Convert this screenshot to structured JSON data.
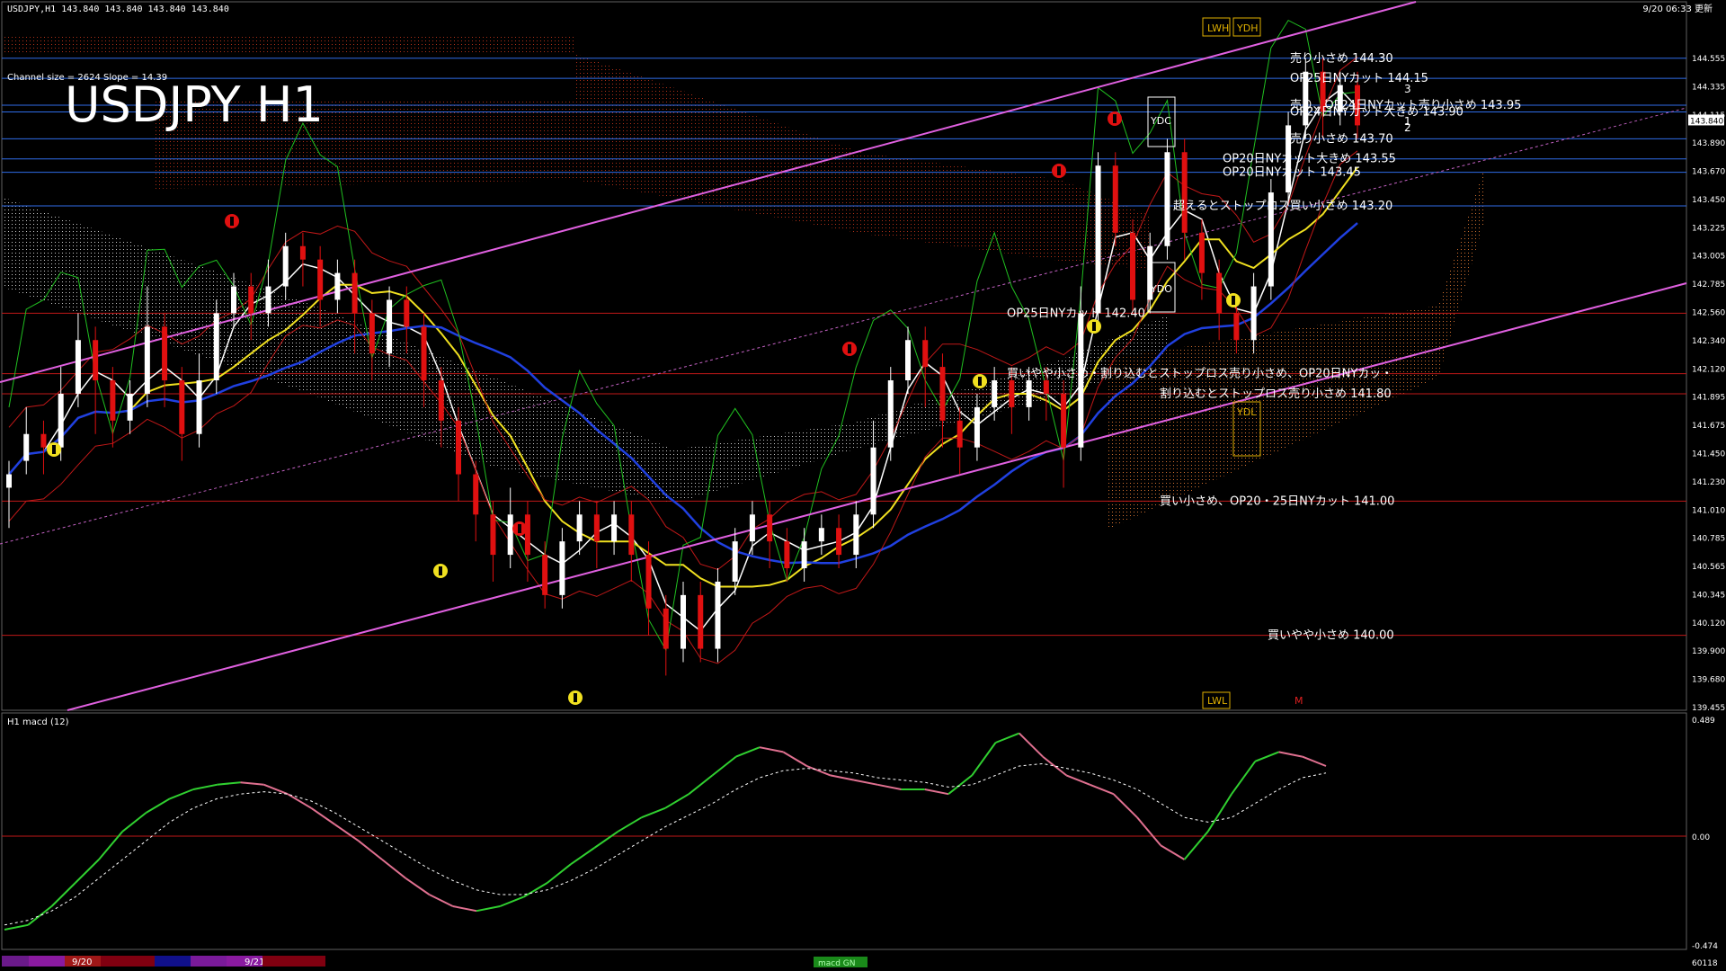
{
  "header": {
    "info_line": "USDJPY,H1  143.840 143.840 143.840 143.840",
    "timestamp": "9/20 06:33 更新",
    "channel_info": "Channel size = 2624 Slope = 14.39",
    "big_title": "USDJPY H1"
  },
  "price_axis": {
    "labels": [
      "144.555",
      "144.335",
      "144.115",
      "143.890",
      "143.670",
      "143.450",
      "143.225",
      "143.005",
      "142.785",
      "142.560",
      "142.340",
      "142.120",
      "141.895",
      "141.675",
      "141.450",
      "141.230",
      "141.010",
      "140.785",
      "140.565",
      "140.345",
      "140.120",
      "139.900",
      "139.680",
      "139.455"
    ],
    "current_price": "143.840"
  },
  "macd": {
    "label": "H1  macd (12)",
    "axis_top": "0.489",
    "axis_zero": "0.00",
    "axis_bottom": "-0.474"
  },
  "date_markers": [
    "9/20",
    "9/21"
  ],
  "bottom_tag": "macd GN",
  "bottom_right_code": "60118",
  "daily_markers": {
    "lwh": "LWH",
    "ydh": "YDH",
    "ydc": "YDC",
    "ydo": "YDO",
    "ydl": "YDL",
    "lwl": "LWL",
    "m": "M"
  },
  "channel_labels": [
    "1",
    "2",
    "3"
  ],
  "order_labels": [
    {
      "text": "売り小さめ 144.30",
      "price": 144.3,
      "color": "#3a6ff0"
    },
    {
      "text": "OP25日NYカット 144.15",
      "price": 144.15,
      "color": "#3a6ff0"
    },
    {
      "text": "売り、OP24日NYカット売り小さめ 143.95",
      "price": 143.95,
      "color": "#3a6ff0"
    },
    {
      "text": "OP24日NYカット大きめ 143.90",
      "price": 143.9,
      "color": "#3a6ff0"
    },
    {
      "text": "売り小さめ 143.70",
      "price": 143.7,
      "color": "#3a6ff0"
    },
    {
      "text": "OP20日NYカット大きめ 143.55",
      "price": 143.55,
      "color": "#3a6ff0"
    },
    {
      "text": "OP20日NYカット 143.45",
      "price": 143.45,
      "color": "#3a6ff0"
    },
    {
      "text": "超えるとストップロス買い小さめ 143.20",
      "price": 143.2,
      "color": "#3a6ff0"
    },
    {
      "text": "OP25日NYカット 142.40",
      "price": 142.4,
      "color": "#c01818"
    },
    {
      "text": "買いやや小さめ・割り込むとストップロス売り小さめ、OP20日NYカッ・",
      "price": 141.95,
      "color": "#c01818"
    },
    {
      "text": "割り込むとストップロス売り小さめ 141.80",
      "price": 141.8,
      "color": "#c01818"
    },
    {
      "text": "買い小さめ、OP20・25日NYカット 141.00",
      "price": 141.0,
      "color": "#c01818"
    },
    {
      "text": "買いやや小さめ 140.00",
      "price": 140.0,
      "color": "#c01818"
    }
  ],
  "chart_data": {
    "type": "candlestick",
    "symbol": "USDJPY",
    "timeframe": "H1",
    "ylim": [
      139.455,
      144.6
    ],
    "candles": [
      [
        141.1,
        141.2,
        140.8,
        141.3
      ],
      [
        141.3,
        141.5,
        141.2,
        141.7
      ],
      [
        141.5,
        141.4,
        141.2,
        141.6
      ],
      [
        141.4,
        141.8,
        141.3,
        142.0
      ],
      [
        141.8,
        142.2,
        141.7,
        142.4
      ],
      [
        142.2,
        141.9,
        141.5,
        142.3
      ],
      [
        141.9,
        141.6,
        141.4,
        142.0
      ],
      [
        141.6,
        141.8,
        141.5,
        141.9
      ],
      [
        141.8,
        142.3,
        141.7,
        142.6
      ],
      [
        142.3,
        141.9,
        141.7,
        142.4
      ],
      [
        141.9,
        141.5,
        141.3,
        142.0
      ],
      [
        141.5,
        141.9,
        141.4,
        142.1
      ],
      [
        141.9,
        142.4,
        141.8,
        142.5
      ],
      [
        142.4,
        142.6,
        142.3,
        142.7
      ],
      [
        142.6,
        142.4,
        142.2,
        142.7
      ],
      [
        142.4,
        142.6,
        142.3,
        142.8
      ],
      [
        142.6,
        142.9,
        142.5,
        143.0
      ],
      [
        142.9,
        142.8,
        142.6,
        143.0
      ],
      [
        142.8,
        142.5,
        142.3,
        142.9
      ],
      [
        142.5,
        142.7,
        142.4,
        142.8
      ],
      [
        142.7,
        142.4,
        142.1,
        142.8
      ],
      [
        142.4,
        142.1,
        141.9,
        142.5
      ],
      [
        142.1,
        142.5,
        142.0,
        142.6
      ],
      [
        142.5,
        142.3,
        142.1,
        142.6
      ],
      [
        142.3,
        141.9,
        141.7,
        142.4
      ],
      [
        141.9,
        141.6,
        141.4,
        142.0
      ],
      [
        141.6,
        141.2,
        141.0,
        141.7
      ],
      [
        141.2,
        140.9,
        140.7,
        141.3
      ],
      [
        140.9,
        140.6,
        140.4,
        141.0
      ],
      [
        140.6,
        140.9,
        140.5,
        141.1
      ],
      [
        140.9,
        140.6,
        140.4,
        141.0
      ],
      [
        140.6,
        140.3,
        140.2,
        140.7
      ],
      [
        140.3,
        140.7,
        140.2,
        140.8
      ],
      [
        140.7,
        140.9,
        140.6,
        141.0
      ],
      [
        140.9,
        140.7,
        140.5,
        141.0
      ],
      [
        140.7,
        140.9,
        140.6,
        141.0
      ],
      [
        140.9,
        140.6,
        140.4,
        141.0
      ],
      [
        140.6,
        140.2,
        140.0,
        140.7
      ],
      [
        140.2,
        139.9,
        139.7,
        140.3
      ],
      [
        139.9,
        140.3,
        139.8,
        140.4
      ],
      [
        140.3,
        139.9,
        139.8,
        140.4
      ],
      [
        139.9,
        140.4,
        139.8,
        140.5
      ],
      [
        140.4,
        140.7,
        140.3,
        140.8
      ],
      [
        140.7,
        140.9,
        140.6,
        141.0
      ],
      [
        140.9,
        140.7,
        140.5,
        141.0
      ],
      [
        140.7,
        140.5,
        140.4,
        140.8
      ],
      [
        140.5,
        140.7,
        140.4,
        140.8
      ],
      [
        140.7,
        140.8,
        140.6,
        140.9
      ],
      [
        140.8,
        140.6,
        140.5,
        140.9
      ],
      [
        140.6,
        140.9,
        140.5,
        141.0
      ],
      [
        140.9,
        141.4,
        140.8,
        141.6
      ],
      [
        141.4,
        141.9,
        141.3,
        142.0
      ],
      [
        141.9,
        142.2,
        141.8,
        142.3
      ],
      [
        142.2,
        142.0,
        141.7,
        142.3
      ],
      [
        142.0,
        141.6,
        141.4,
        142.1
      ],
      [
        141.6,
        141.4,
        141.2,
        141.7
      ],
      [
        141.4,
        141.7,
        141.3,
        141.8
      ],
      [
        141.7,
        141.9,
        141.6,
        142.0
      ],
      [
        141.9,
        141.7,
        141.5,
        142.0
      ],
      [
        141.7,
        141.9,
        141.6,
        142.0
      ],
      [
        141.9,
        141.8,
        141.6,
        142.0
      ],
      [
        141.8,
        141.4,
        141.1,
        141.9
      ],
      [
        141.4,
        142.4,
        141.3,
        142.6
      ],
      [
        142.4,
        143.5,
        142.3,
        143.6
      ],
      [
        143.5,
        143.0,
        142.9,
        143.6
      ],
      [
        143.0,
        142.5,
        142.4,
        143.1
      ],
      [
        142.5,
        142.9,
        142.4,
        143.0
      ],
      [
        142.9,
        143.6,
        142.8,
        143.7
      ],
      [
        143.6,
        143.0,
        142.8,
        143.7
      ],
      [
        143.0,
        142.7,
        142.5,
        143.1
      ],
      [
        142.7,
        142.4,
        142.2,
        142.8
      ],
      [
        142.4,
        142.2,
        142.1,
        142.5
      ],
      [
        142.2,
        142.6,
        142.1,
        142.7
      ],
      [
        142.6,
        143.3,
        142.5,
        143.4
      ],
      [
        143.3,
        143.8,
        143.2,
        143.9
      ],
      [
        143.8,
        144.2,
        143.7,
        144.3
      ],
      [
        144.2,
        143.9,
        143.7,
        144.3
      ],
      [
        143.9,
        144.1,
        143.8,
        144.2
      ],
      [
        144.1,
        143.8,
        143.7,
        144.2
      ]
    ],
    "horizontal_levels_blue": [
      144.3,
      144.15,
      143.95,
      143.9,
      143.7,
      143.55,
      143.45,
      143.2
    ],
    "horizontal_levels_red": [
      142.4,
      141.95,
      141.8,
      141.0,
      140.0
    ],
    "macd_values": [
      -0.4,
      -0.38,
      -0.3,
      -0.2,
      -0.1,
      0.02,
      0.1,
      0.16,
      0.2,
      0.22,
      0.23,
      0.22,
      0.18,
      0.12,
      0.05,
      -0.02,
      -0.1,
      -0.18,
      -0.25,
      -0.3,
      -0.32,
      -0.3,
      -0.26,
      -0.2,
      -0.12,
      -0.05,
      0.02,
      0.08,
      0.12,
      0.18,
      0.26,
      0.34,
      0.38,
      0.36,
      0.3,
      0.26,
      0.24,
      0.22,
      0.2,
      0.2,
      0.18,
      0.26,
      0.4,
      0.44,
      0.34,
      0.26,
      0.22,
      0.18,
      0.08,
      -0.04,
      -0.1,
      0.02,
      0.18,
      0.32,
      0.36,
      0.34,
      0.3
    ],
    "macd_signal": [
      -0.38,
      -0.36,
      -0.32,
      -0.26,
      -0.18,
      -0.1,
      -0.02,
      0.06,
      0.12,
      0.16,
      0.18,
      0.19,
      0.18,
      0.15,
      0.1,
      0.04,
      -0.02,
      -0.08,
      -0.14,
      -0.19,
      -0.23,
      -0.25,
      -0.25,
      -0.23,
      -0.19,
      -0.14,
      -0.08,
      -0.02,
      0.04,
      0.09,
      0.14,
      0.2,
      0.25,
      0.28,
      0.29,
      0.28,
      0.27,
      0.25,
      0.24,
      0.23,
      0.21,
      0.22,
      0.26,
      0.3,
      0.31,
      0.29,
      0.27,
      0.24,
      0.2,
      0.14,
      0.08,
      0.06,
      0.08,
      0.14,
      0.2,
      0.25,
      0.27
    ]
  }
}
